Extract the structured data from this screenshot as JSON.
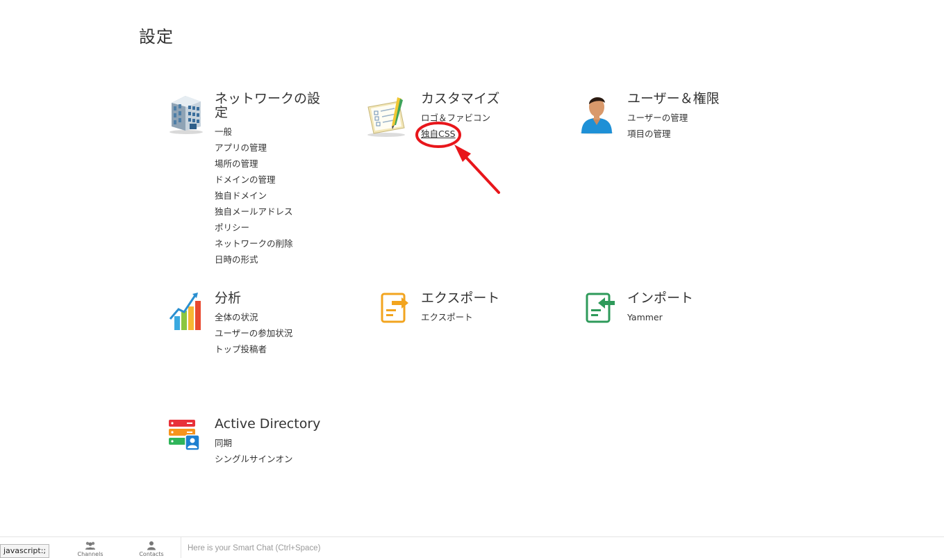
{
  "page": {
    "title": "設定"
  },
  "sections": {
    "network": {
      "title": "ネットワークの設定",
      "items": [
        "一般",
        "アプリの管理",
        "場所の管理",
        "ドメインの管理",
        "独自ドメイン",
        "独自メールアドレス",
        "ポリシー",
        "ネットワークの削除",
        "日時の形式"
      ]
    },
    "customize": {
      "title": "カスタマイズ",
      "items": [
        "ロゴ＆ファビコン",
        "独自CSS"
      ]
    },
    "users": {
      "title": "ユーザー＆権限",
      "items": [
        "ユーザーの管理",
        "項目の管理"
      ]
    },
    "analysis": {
      "title": "分析",
      "items": [
        "全体の状況",
        "ユーザーの参加状況",
        "トップ投稿者"
      ]
    },
    "export": {
      "title": "エクスポート",
      "items": [
        "エクスポート"
      ]
    },
    "import": {
      "title": "インポート",
      "items": [
        "Yammer"
      ]
    },
    "active_directory": {
      "title": "Active Directory",
      "items": [
        "同期",
        "シングルサインオン"
      ]
    }
  },
  "icons": {
    "network": "building-icon",
    "customize": "checklist-icon",
    "users": "user-avatar-icon",
    "analysis": "bar-chart-icon",
    "export": "export-icon",
    "import": "import-icon",
    "active_directory": "directory-server-icon"
  },
  "annotation": {
    "color": "#e8161b"
  },
  "bottom_bar": {
    "status_tip": "javascript:;",
    "channels_label": "Channels",
    "contacts_label": "Contacts",
    "chat_placeholder": "Here is your Smart Chat (Ctrl+Space)"
  }
}
